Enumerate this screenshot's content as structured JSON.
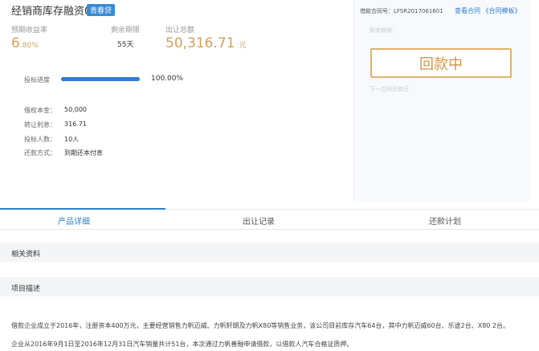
{
  "product": {
    "title": "经销商库存融资006",
    "badge": "青春贷"
  },
  "stats": {
    "rate_label": "预期收益率",
    "rate_int": "6",
    "rate_dec": ".80%",
    "term_label": "剩余期限",
    "term_value": "55天",
    "amount_label": "出让总额",
    "amount_value": "50,316.71",
    "amount_unit": "元"
  },
  "progress": {
    "label": "投标进度",
    "value": "100.00%",
    "fraction": 1.0
  },
  "info": [
    {
      "label": "借权本金：",
      "value": "50,000"
    },
    {
      "label": "转让利息：",
      "value": "316.71"
    },
    {
      "label": "投标人数：",
      "value": "10人"
    },
    {
      "label": "还款方式：",
      "value": "到期还本付息"
    }
  ],
  "panel": {
    "contract_label": "借款合同号：",
    "contract_no": "LFSR2017061601",
    "view_contract": "查看合同",
    "template_link": "《合同模板》",
    "remaining_label": "剩余期限：",
    "status_button": "回款中",
    "next_date_label": "下一合同还款日"
  },
  "tabs": [
    {
      "label": "产品详细"
    },
    {
      "label": "出让记录"
    },
    {
      "label": "还款计划"
    }
  ],
  "sections": {
    "materials": "相关资料",
    "description": "项目描述"
  },
  "description": [
    "借款企业成立于2016年，注册资本400万元，主要经营销售力帆迈威、力帆轩朗及力帆X80等销售业务，该公司目前库存汽车64台，其中力帆迈威60台、乐途2台、X80 2台。",
    "企业从2016年9月1日至2016年12月31日汽车销量共计51台，本次通过力帆善融申请借款，以借款人汽车合格证质押。"
  ]
}
